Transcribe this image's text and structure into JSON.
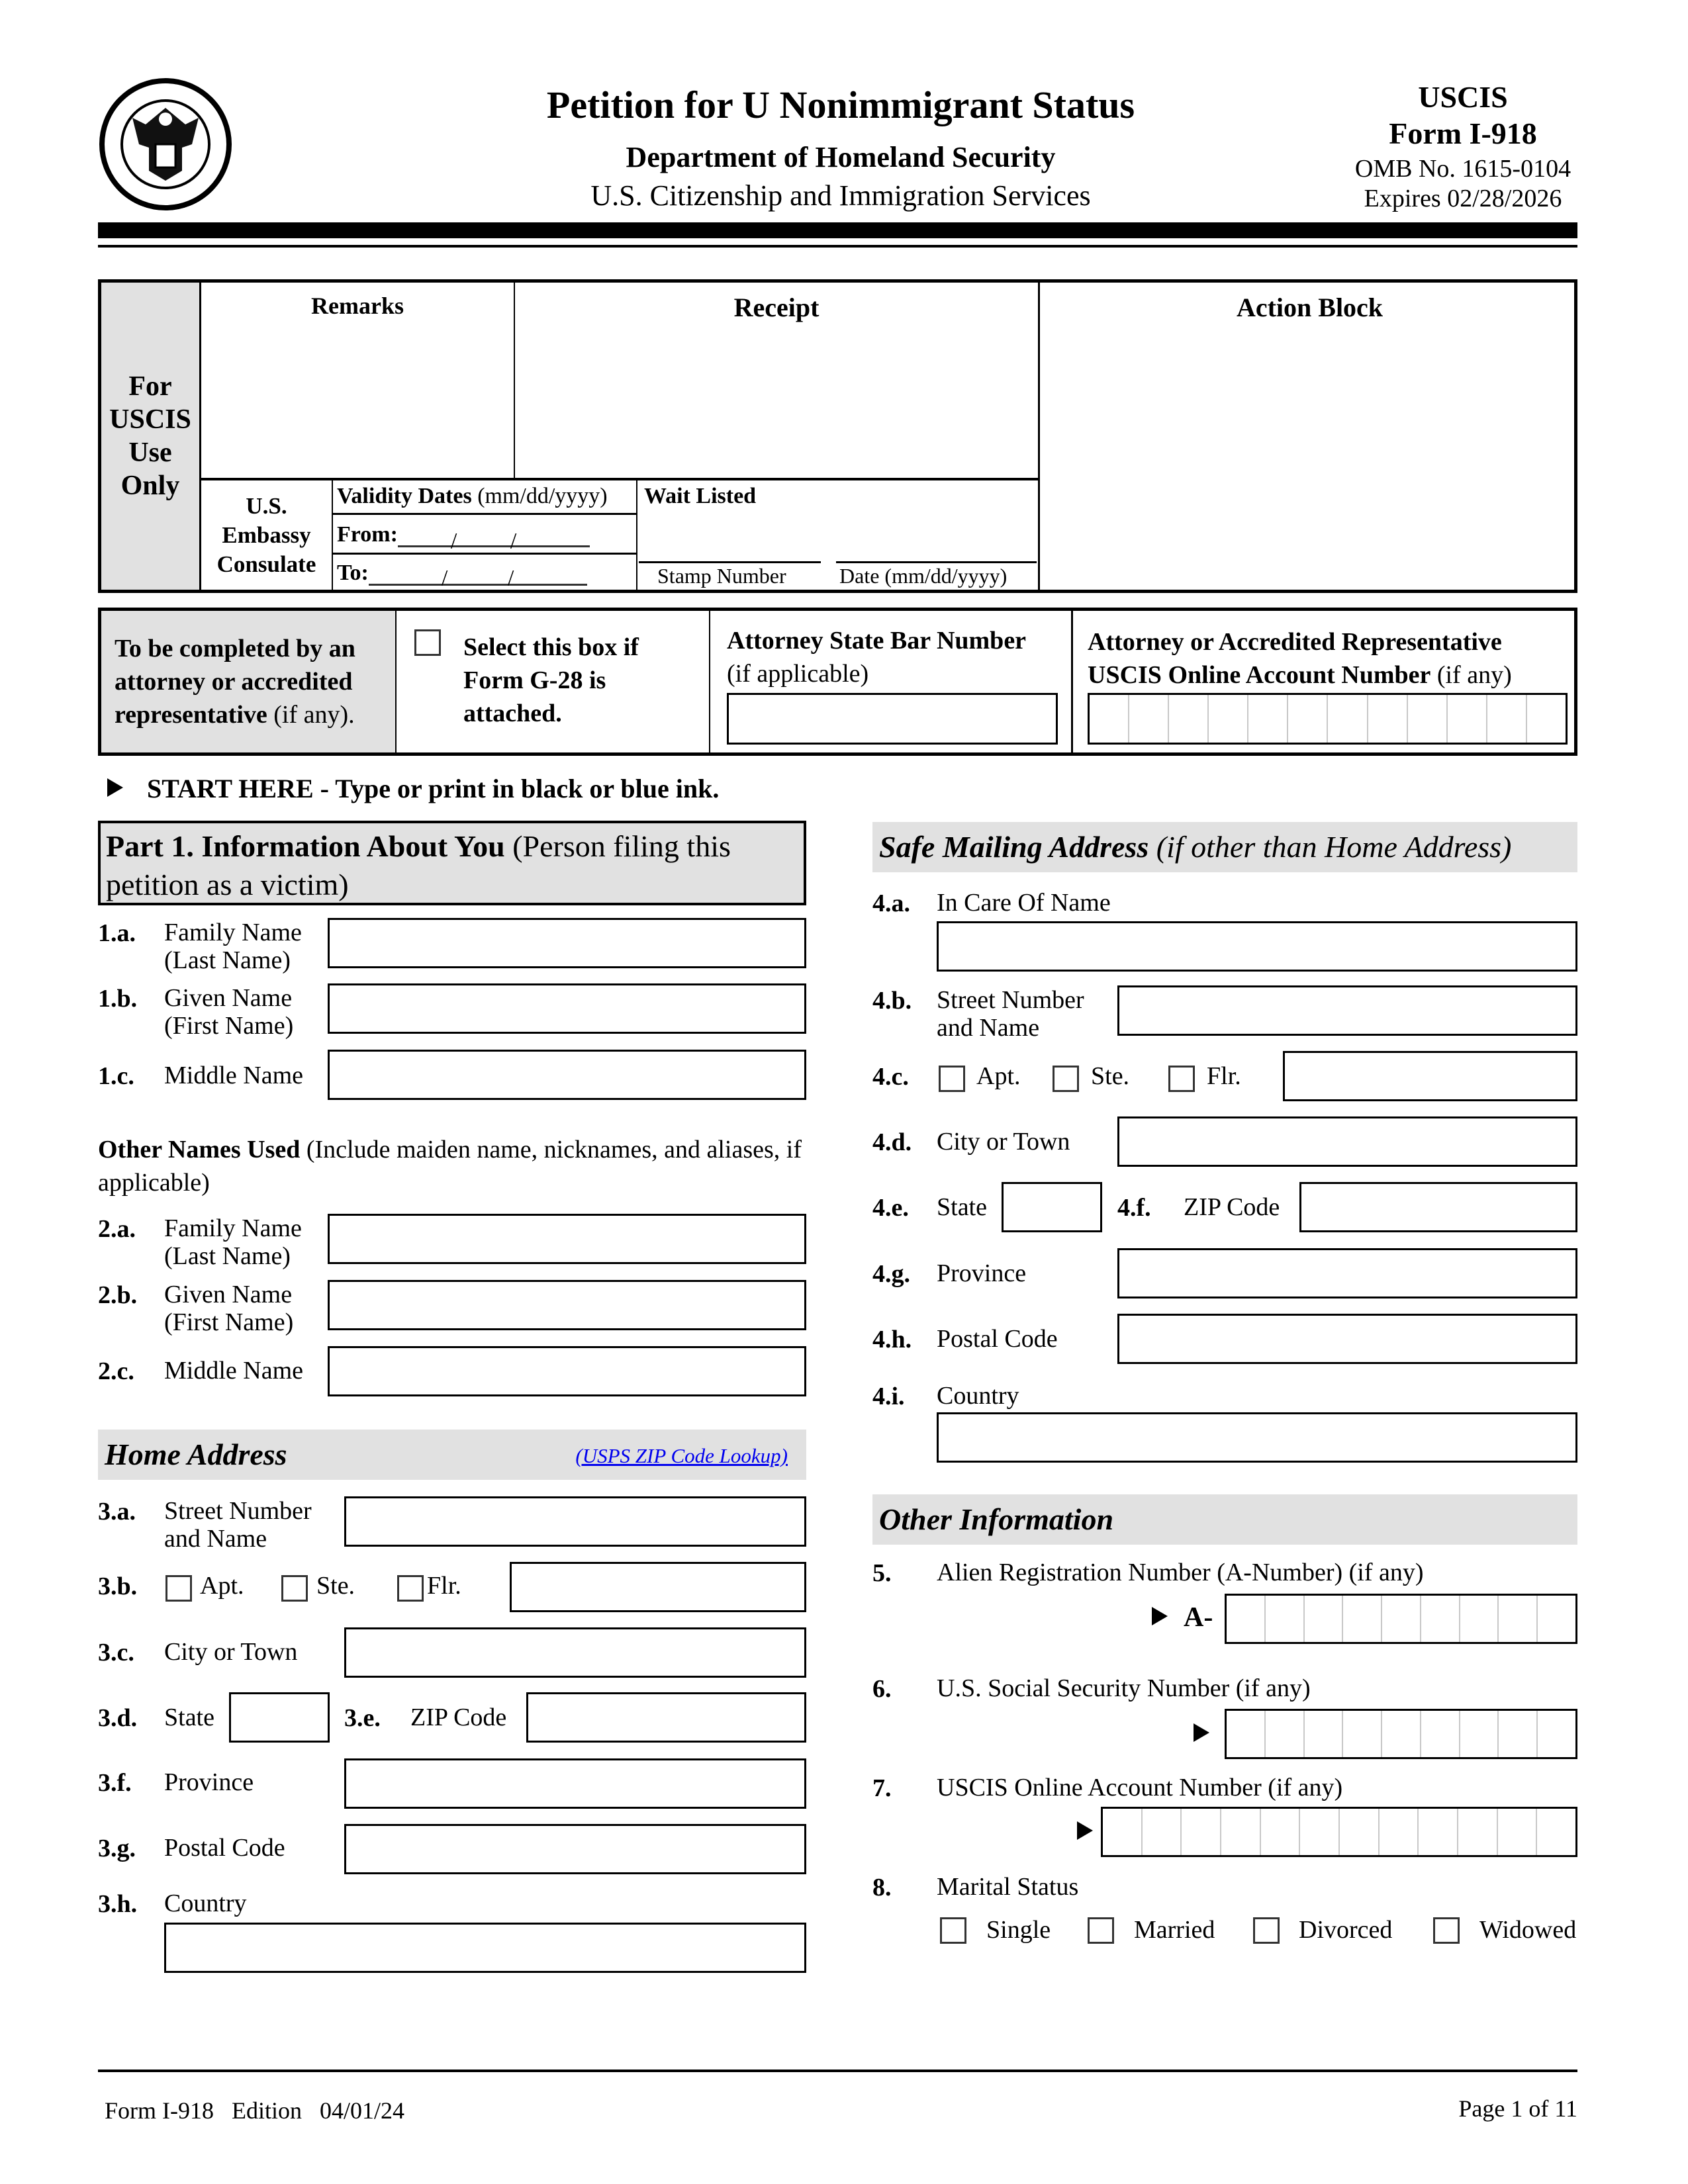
{
  "header": {
    "title": "Petition for U Nonimmigrant Status",
    "dept": "Department of Homeland Security",
    "agency": "U.S. Citizenship and Immigration Services",
    "uscis": "USCIS",
    "form": "Form I-918",
    "omb": "OMB No. 1615-0104",
    "expires": "Expires 02/28/2026",
    "seal_icon": "dhs-seal"
  },
  "office_box": {
    "side": [
      "For",
      "USCIS",
      "Use",
      "Only"
    ],
    "remarks": "Remarks",
    "receipt": "Receipt",
    "action_block": "Action Block",
    "embassy": [
      "U.S.",
      "Embassy",
      "Consulate"
    ],
    "validity_bold": "Validity Dates",
    "validity_rest": " (mm/dd/yyyy)",
    "from": "From:",
    "to": "To:",
    "wait_listed": "Wait Listed",
    "stamp_number": "Stamp Number",
    "date": "Date (mm/dd/yyyy)"
  },
  "attorney": {
    "side_bold": "To be completed by an attorney or accredited representative",
    "side_rest": " (if any).",
    "g28_label": "Select this box if Form G-28 is attached.",
    "bar_bold": "Attorney State Bar Number",
    "bar_rest": "(if applicable)",
    "acct_line1": "Attorney or Accredited Representative",
    "acct_bold": "USCIS Online Account Number",
    "acct_rest": " (if any)"
  },
  "start_here": "START HERE - Type or print in black or blue ink.",
  "part1": {
    "title_bold": "Part 1.  Information About You",
    "title_rest": " (Person filing this petition as a victim)",
    "fields": [
      {
        "num": "1.a.",
        "label1": "Family Name",
        "label2": "(Last Name)"
      },
      {
        "num": "1.b.",
        "label1": "Given Name",
        "label2": "(First Name)"
      },
      {
        "num": "1.c.",
        "label1": "Middle Name",
        "label2": ""
      }
    ],
    "other_names_bold": "Other Names Used",
    "other_names_rest": " (Include maiden name, nicknames, and aliases, if applicable)",
    "other_fields": [
      {
        "num": "2.a.",
        "label1": "Family Name",
        "label2": "(Last Name)"
      },
      {
        "num": "2.b.",
        "label1": "Given Name",
        "label2": "(First Name)"
      },
      {
        "num": "2.c.",
        "label1": "Middle Name",
        "label2": ""
      }
    ]
  },
  "home_address": {
    "title": "Home Address",
    "link": "(USPS ZIP Code Lookup)",
    "link_color": "#0000ee",
    "street_num": "3.a.",
    "street1": "Street Number",
    "street2": "and Name",
    "unit_num": "3.b.",
    "apt": "Apt.",
    "ste": "Ste.",
    "flr": "Flr.",
    "city_num": "3.c.",
    "city": "City or Town",
    "state_num": "3.d.",
    "state": "State",
    "zip_num": "3.e.",
    "zip": "ZIP Code",
    "province_num": "3.f.",
    "province": "Province",
    "postal_num": "3.g.",
    "postal": "Postal Code",
    "country_num": "3.h.",
    "country": "Country"
  },
  "safe_address": {
    "title_bold": "Safe Mailing Address",
    "title_rest": " (if other than Home Address)",
    "care_num": "4.a.",
    "care": "In Care Of Name",
    "street_num": "4.b.",
    "street1": "Street Number",
    "street2": "and Name",
    "unit_num": "4.c.",
    "apt": "Apt.",
    "ste": "Ste.",
    "flr": "Flr.",
    "city_num": "4.d.",
    "city": "City or Town",
    "state_num": "4.e.",
    "state": "State",
    "zip_num": "4.f.",
    "zip": "ZIP Code",
    "province_num": "4.g.",
    "province": "Province",
    "postal_num": "4.h.",
    "postal": "Postal Code",
    "country_num": "4.i.",
    "country": "Country"
  },
  "other_info": {
    "title": "Other Information",
    "anum_num": "5.",
    "anum": "Alien Registration Number (A-Number) (if any)",
    "anum_prefix": "A-",
    "ssn_num": "6.",
    "ssn": "U.S. Social Security Number (if any)",
    "acct_num": "7.",
    "acct": "USCIS Online Account Number (if any)",
    "marital_num": "8.",
    "marital": "Marital Status",
    "marital_options": [
      "Single",
      "Married",
      "Divorced",
      "Widowed"
    ]
  },
  "footer": {
    "left": "Form I-918   Edition   04/01/24",
    "right": "Page 1 of 11"
  }
}
